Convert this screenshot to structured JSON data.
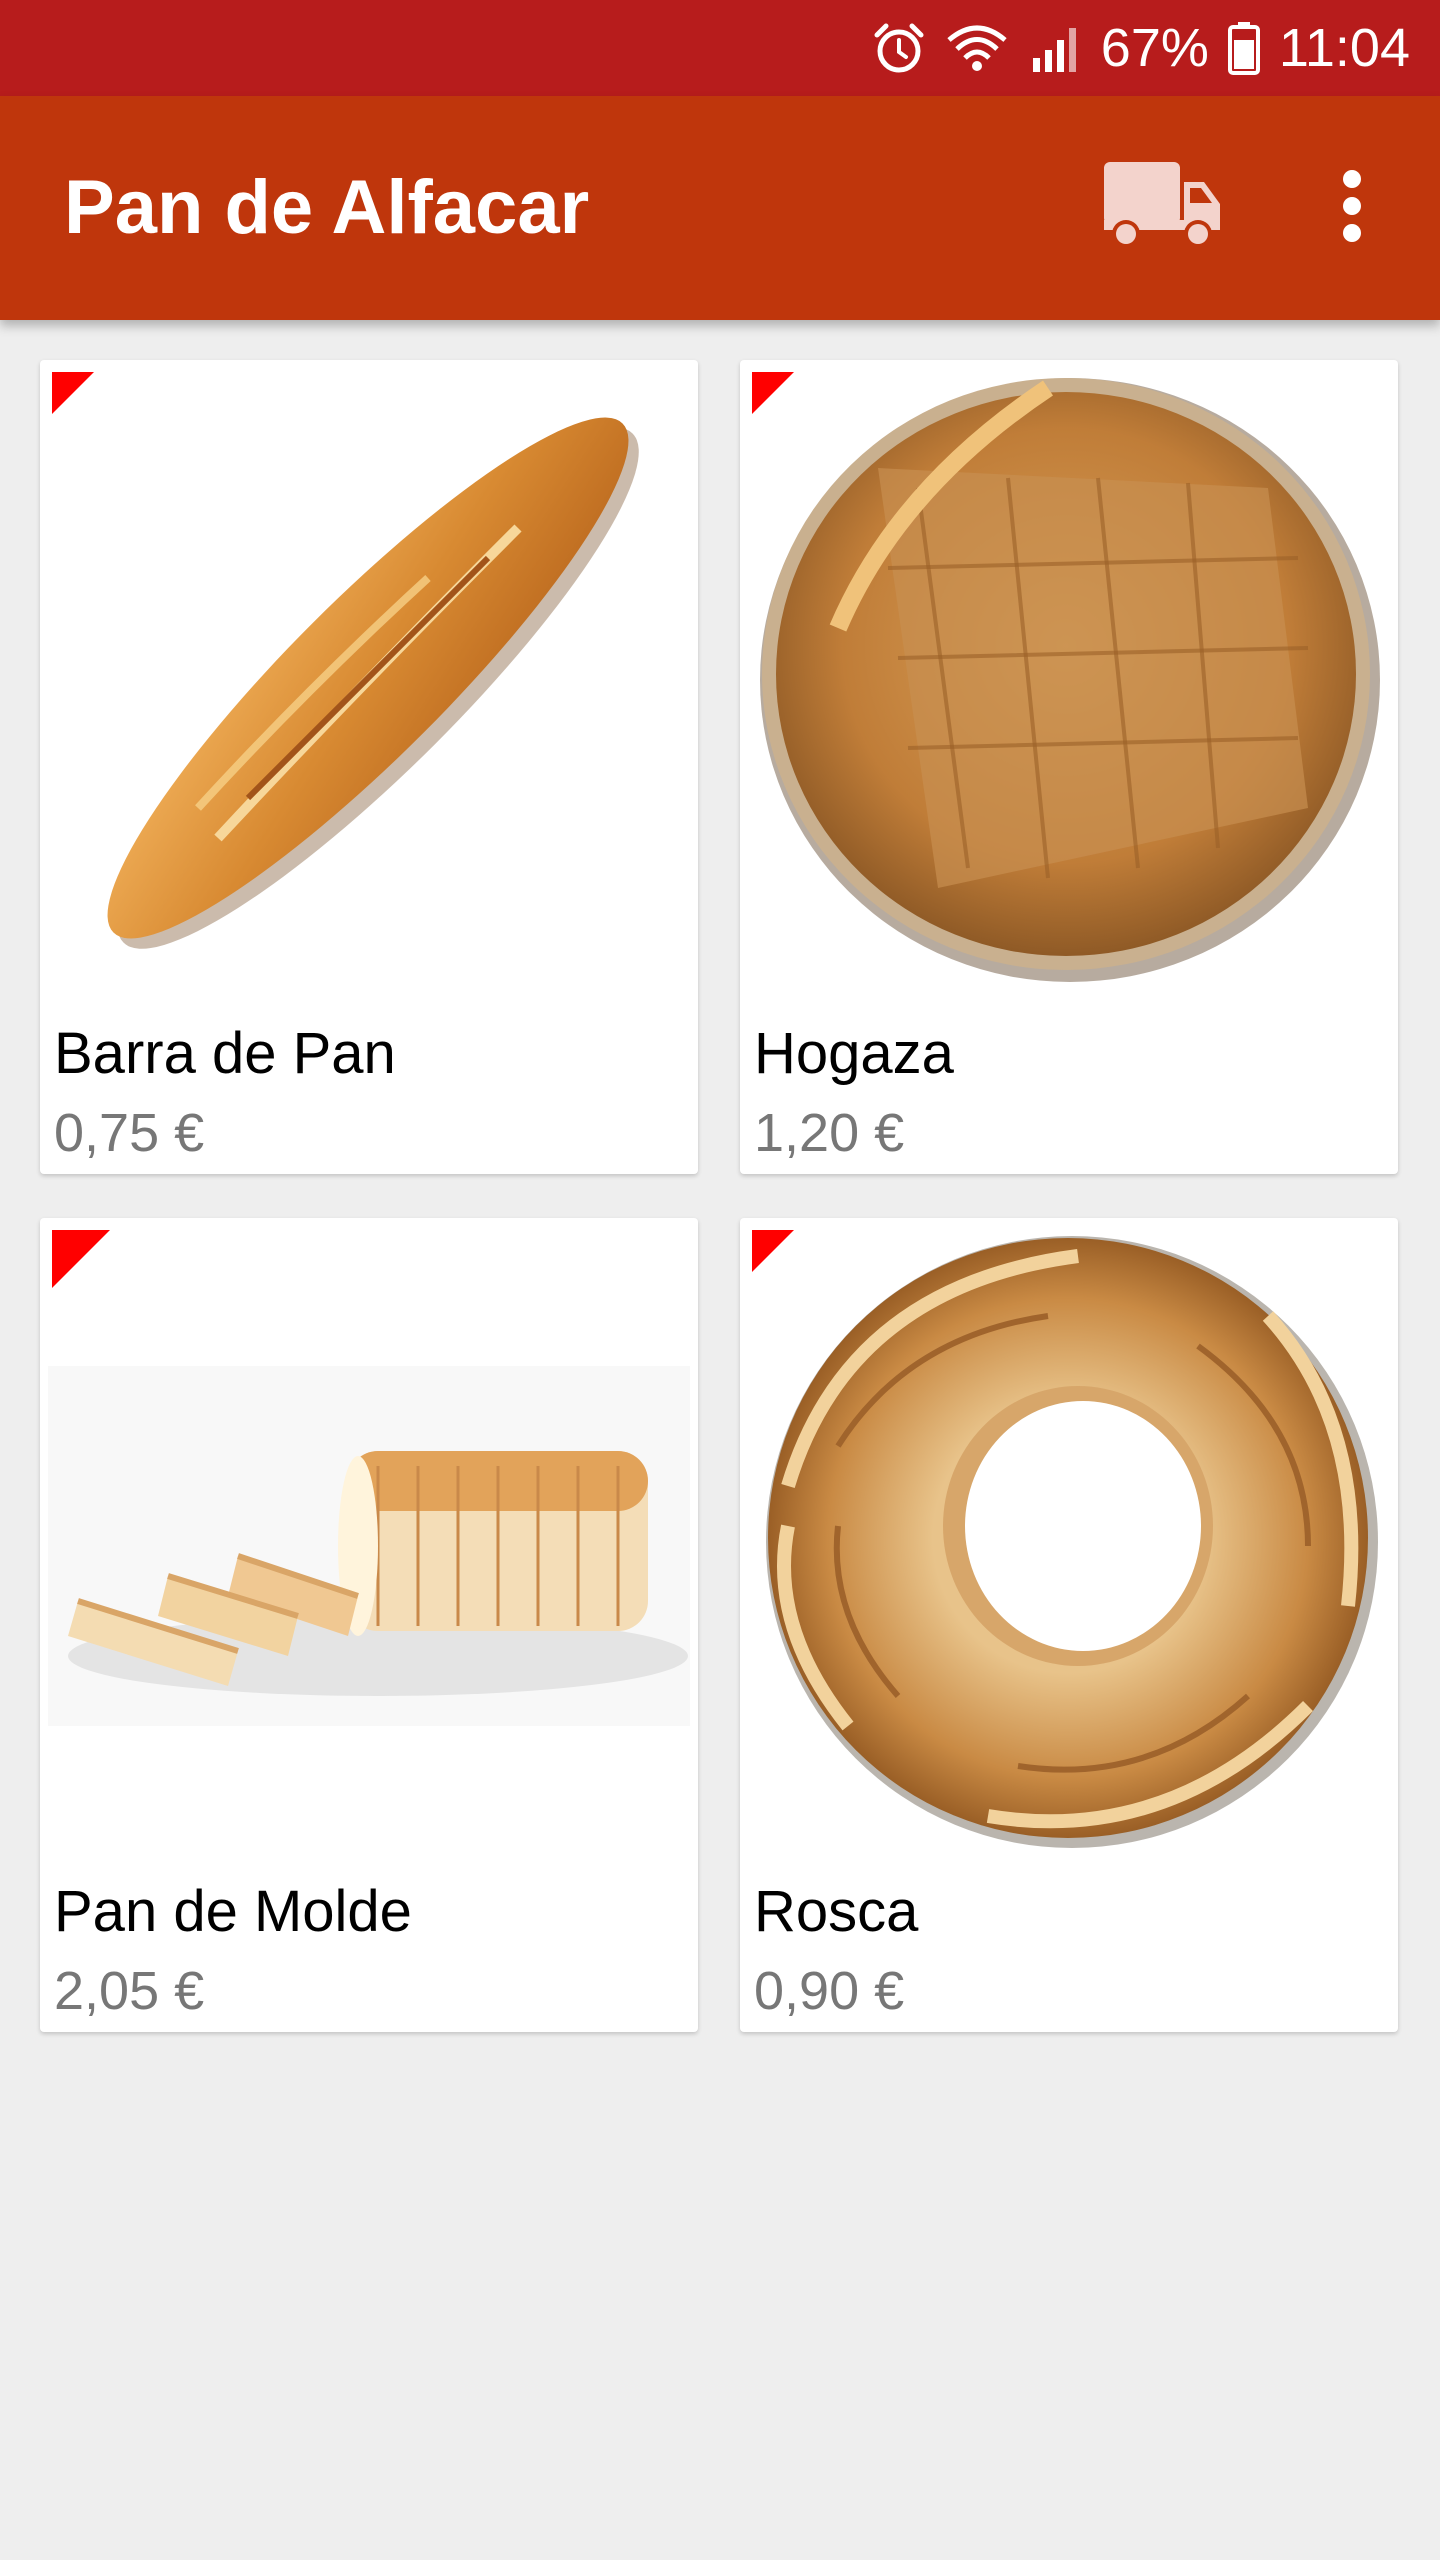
{
  "status_bar": {
    "battery": "67%",
    "time": "11:04",
    "icons": [
      "alarm-icon",
      "wifi-icon",
      "signal-icon",
      "battery-icon"
    ]
  },
  "app_bar": {
    "title": "Pan de Alfacar",
    "actions": [
      "truck-icon",
      "more-vert-icon"
    ]
  },
  "products": [
    {
      "name": "Barra de Pan",
      "price": "0,75 €"
    },
    {
      "name": "Hogaza",
      "price": "1,20 €"
    },
    {
      "name": "Pan de Molde",
      "price": "2,05 €"
    },
    {
      "name": "Rosca",
      "price": "0,90 €"
    }
  ],
  "colors": {
    "status_bar": "#b71c1c",
    "app_bar": "#bf360c",
    "corner_flag": "#ff0000",
    "price_text": "#777777",
    "background": "#eeeeee"
  }
}
